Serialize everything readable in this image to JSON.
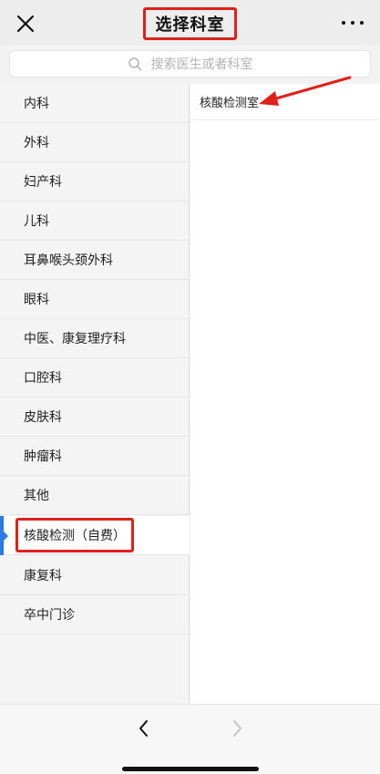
{
  "header": {
    "title": "选择科室"
  },
  "search": {
    "placeholder": "搜索医生或者科室"
  },
  "departments": [
    {
      "label": "内科"
    },
    {
      "label": "外科"
    },
    {
      "label": "妇产科"
    },
    {
      "label": "儿科"
    },
    {
      "label": "耳鼻喉头颈外科"
    },
    {
      "label": "眼科"
    },
    {
      "label": "中医、康复理疗科"
    },
    {
      "label": "口腔科"
    },
    {
      "label": "皮肤科"
    },
    {
      "label": "肿瘤科"
    },
    {
      "label": "其他"
    },
    {
      "label": "核酸检测（自费）",
      "selected": true
    },
    {
      "label": "康复科"
    },
    {
      "label": "卒中门诊"
    }
  ],
  "sub_departments": [
    {
      "label": "核酸检测室"
    }
  ],
  "colors": {
    "highlight": "#e0201a",
    "active_indicator": "#2c7be5"
  },
  "icons": [
    "close-icon",
    "more-icon",
    "search-icon",
    "chevron-left-icon",
    "chevron-right-icon"
  ]
}
